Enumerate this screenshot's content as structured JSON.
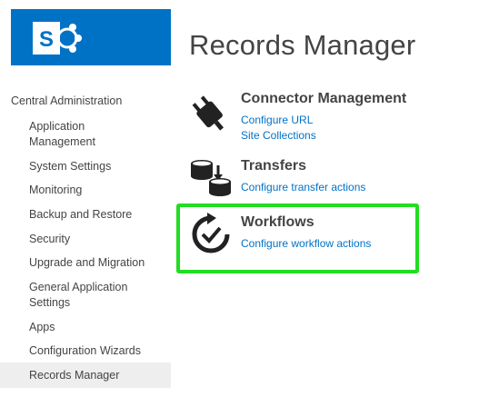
{
  "logo": {
    "letter": "S",
    "icon": "sharepoint-logo-icon",
    "color": "#0072c6"
  },
  "page_title": "Records Manager",
  "nav": {
    "root": "Central Administration",
    "items": [
      {
        "label": "Application Management"
      },
      {
        "label": "System Settings"
      },
      {
        "label": "Monitoring"
      },
      {
        "label": "Backup and Restore"
      },
      {
        "label": "Security"
      },
      {
        "label": "Upgrade and Migration"
      },
      {
        "label": "General Application Settings"
      },
      {
        "label": "Apps"
      },
      {
        "label": "Configuration Wizards"
      },
      {
        "label": "Records Manager",
        "selected": true
      }
    ]
  },
  "sections": [
    {
      "title": "Connector Management",
      "icon": "plug-icon",
      "links": [
        "Configure URL",
        "Site Collections"
      ]
    },
    {
      "title": "Transfers",
      "icon": "database-transfer-icon",
      "links": [
        "Configure transfer actions"
      ]
    },
    {
      "title": "Workflows",
      "icon": "workflow-cycle-icon",
      "links": [
        "Configure workflow actions"
      ],
      "highlighted": true
    }
  ],
  "colors": {
    "link": "#0072c6",
    "accent": "#0072c6",
    "highlight": "#22dd22",
    "text": "#444444"
  }
}
